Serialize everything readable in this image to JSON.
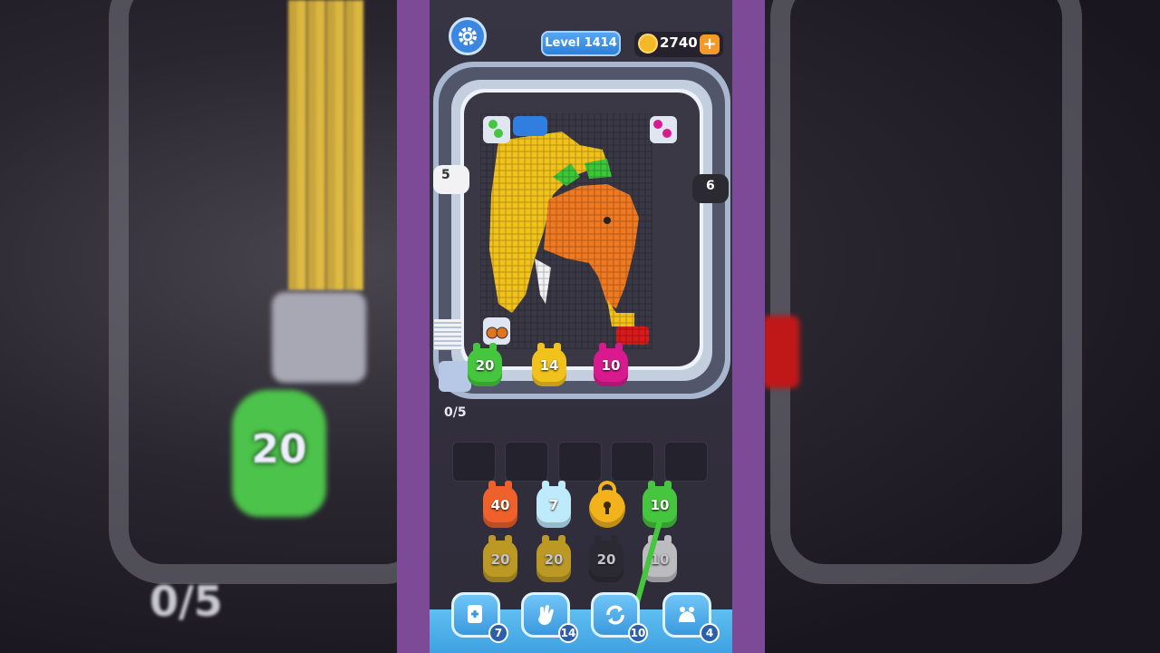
{
  "header": {
    "level_label": "Level 1414",
    "coins": "2740",
    "coin_add": "+"
  },
  "gates": {
    "left": "5",
    "right": "6"
  },
  "shooters_on_track": [
    {
      "value": "20",
      "color": "#46c63f"
    },
    {
      "value": "14",
      "color": "#f2c21c"
    },
    {
      "value": "10",
      "color": "#d91a8e"
    }
  ],
  "progress": "0/5",
  "queue": {
    "row1": [
      {
        "value": "40",
        "color": "#f0602a"
      },
      {
        "value": "7",
        "color": "#bfeafc"
      },
      {
        "value": "",
        "color": "#f2b21c",
        "locked": true
      },
      {
        "value": "10",
        "color": "#46c63f"
      }
    ],
    "row2": [
      {
        "value": "20",
        "color": "#f2c21c"
      },
      {
        "value": "20",
        "color": "#f2c21c"
      },
      {
        "value": "20",
        "color": "#2a2a30"
      },
      {
        "value": "10",
        "color": "#f2f2f4"
      }
    ]
  },
  "boosters": [
    {
      "name": "add-slot",
      "count": "7"
    },
    {
      "name": "hand",
      "count": "14"
    },
    {
      "name": "shuffle",
      "count": "10"
    },
    {
      "name": "magic",
      "count": "4"
    }
  ],
  "background_text": {
    "big_value": "20",
    "progress": "0/5"
  }
}
